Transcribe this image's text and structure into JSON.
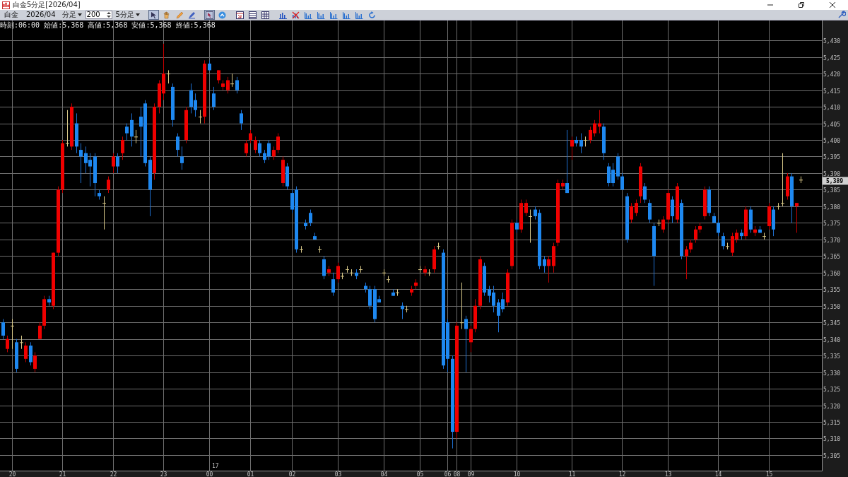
{
  "window": {
    "title": "白金5分足[2026/04]"
  },
  "toolbar": {
    "symbol": "白金",
    "month": "2026/04",
    "unit": "分足",
    "count": "200",
    "period": "5分足",
    "tools": [
      {
        "kind": "select",
        "selected": true
      },
      {
        "kind": "hand",
        "selected": false
      },
      {
        "kind": "pencil",
        "selected": false
      },
      {
        "kind": "pen",
        "selected": false
      },
      {
        "kind": "pointer",
        "selected": true
      },
      {
        "kind": "circle",
        "selected": false
      },
      {
        "kind": "window",
        "selected": false
      },
      {
        "kind": "list",
        "selected": false
      },
      {
        "kind": "grid",
        "selected": false
      },
      {
        "kind": "barsmenu",
        "selected": false
      },
      {
        "kind": "delete",
        "selected": false
      },
      {
        "kind": "bars",
        "selected": false
      },
      {
        "kind": "bars",
        "selected": false
      },
      {
        "kind": "bars",
        "selected": false
      },
      {
        "kind": "bars",
        "selected": false
      },
      {
        "kind": "bars",
        "selected": false
      },
      {
        "kind": "refresh",
        "selected": false
      }
    ]
  },
  "info_line": "時刻:06:00 始値:5,368 高値:5,368 安値:5,368 終値:5,368",
  "chart": {
    "date_marker": "17",
    "last_price": "5,389",
    "chart_data": {
      "type": "candlestick",
      "categories": [
        null,
        null,
        "20",
        null,
        null,
        null,
        null,
        null,
        null,
        null,
        null,
        null,
        null,
        "21",
        null,
        null,
        null,
        null,
        null,
        null,
        null,
        null,
        null,
        null,
        "22",
        null,
        null,
        null,
        null,
        null,
        null,
        null,
        null,
        null,
        null,
        "23",
        null,
        null,
        null,
        null,
        null,
        null,
        null,
        null,
        null,
        "00",
        null,
        null,
        null,
        null,
        null,
        null,
        null,
        null,
        "01",
        null,
        null,
        null,
        null,
        null,
        null,
        null,
        null,
        "02",
        null,
        null,
        null,
        null,
        null,
        null,
        null,
        null,
        null,
        "03",
        null,
        null,
        null,
        null,
        null,
        null,
        null,
        null,
        null,
        "04",
        null,
        null,
        null,
        null,
        null,
        null,
        null,
        "05",
        null,
        null,
        null,
        null,
        null,
        "06",
        null,
        "08",
        null,
        null,
        "09",
        null,
        null,
        null,
        null,
        null,
        null,
        null,
        null,
        null,
        "10",
        null,
        null,
        null,
        null,
        null,
        null,
        null,
        null,
        null,
        null,
        null,
        "11",
        null,
        null,
        null,
        null,
        null,
        null,
        null,
        null,
        null,
        null,
        "12",
        null,
        null,
        null,
        null,
        null,
        null,
        null,
        null,
        null,
        "13",
        null,
        null,
        null,
        null,
        null,
        null,
        null,
        null,
        null,
        null,
        "14",
        null,
        null,
        null,
        null,
        null,
        null,
        null,
        null,
        null,
        null,
        "15",
        null,
        null,
        null,
        null,
        null,
        null,
        null
      ],
      "ohlc": [
        [
          5345,
          5346,
          5340,
          5341
        ],
        [
          5337,
          5341,
          5336,
          5340
        ],
        [
          5344,
          5346,
          5337,
          5344
        ],
        [
          5339,
          5340,
          5330,
          5331
        ],
        [
          5339,
          5341,
          5337,
          5339
        ],
        [
          5334,
          5339,
          5333,
          5338
        ],
        [
          5338,
          5339,
          5332,
          5333
        ],
        [
          5331,
          5336,
          5330,
          5335
        ],
        [
          5340,
          5345,
          5340,
          5344
        ],
        [
          5344,
          5353,
          5343,
          5352
        ],
        [
          5352,
          5353,
          5350,
          5351
        ],
        [
          5350,
          5366,
          5349,
          5366
        ],
        [
          5366,
          5386,
          5365,
          5385
        ],
        [
          5385,
          5400,
          5384,
          5399
        ],
        [
          5399,
          5409,
          5398,
          5399
        ],
        [
          5398,
          5411,
          5397,
          5410
        ],
        [
          5405,
          5408,
          5396,
          5398
        ],
        [
          5397,
          5399,
          5387,
          5395
        ],
        [
          5396,
          5398,
          5390,
          5393
        ],
        [
          5394,
          5396,
          5386,
          5392
        ],
        [
          5395,
          5396,
          5383,
          5387
        ],
        [
          5384,
          5385,
          5382,
          5383
        ],
        [
          5381,
          5383,
          5373,
          5381
        ],
        [
          5385,
          5389,
          5384,
          5388
        ],
        [
          5392,
          5396,
          5390,
          5395
        ],
        [
          5395,
          5396,
          5390,
          5392
        ],
        [
          5396,
          5401,
          5394,
          5400
        ],
        [
          5404,
          5405,
          5400,
          5402
        ],
        [
          5406,
          5408,
          5398,
          5401
        ],
        [
          5401,
          5403,
          5399,
          5401
        ],
        [
          5407,
          5410,
          5395,
          5404
        ],
        [
          5411,
          5412,
          5392,
          5393
        ],
        [
          5394,
          5395,
          5377,
          5385
        ],
        [
          5390,
          5411,
          5388,
          5410
        ],
        [
          5410,
          5418,
          5408,
          5417
        ],
        [
          5414,
          5429,
          5412,
          5420
        ],
        [
          5420,
          5421,
          5417,
          5420
        ],
        [
          5416,
          5417,
          5404,
          5406
        ],
        [
          5401,
          5402,
          5395,
          5397
        ],
        [
          5395,
          5398,
          5391,
          5393
        ],
        [
          5400,
          5410,
          5399,
          5409
        ],
        [
          5415,
          5417,
          5408,
          5410
        ],
        [
          5412,
          5414,
          5407,
          5409
        ],
        [
          5407,
          5409,
          5405,
          5407
        ],
        [
          5407,
          5424,
          5405,
          5423
        ],
        [
          5423,
          5424,
          5421,
          5421
        ],
        [
          5414,
          5416,
          5409,
          5410
        ],
        [
          5418,
          5421,
          5417,
          5421
        ],
        [
          5416,
          5418,
          5415,
          5417
        ],
        [
          5415,
          5419,
          5414,
          5418
        ],
        [
          5417,
          5420,
          5416,
          5417
        ],
        [
          5418,
          5419,
          5414,
          5415
        ],
        [
          5408,
          5409,
          5403,
          5405
        ],
        [
          5396,
          5400,
          5395,
          5399
        ],
        [
          5400,
          5403,
          5399,
          5402
        ],
        [
          5397,
          5401,
          5396,
          5400
        ],
        [
          5399,
          5400,
          5395,
          5396
        ],
        [
          5396,
          5397,
          5393,
          5394
        ],
        [
          5399,
          5400,
          5394,
          5395
        ],
        [
          5395,
          5398,
          5394,
          5397
        ],
        [
          5397,
          5402,
          5396,
          5401
        ],
        [
          5387,
          5395,
          5386,
          5394
        ],
        [
          5392,
          5393,
          5385,
          5386
        ],
        [
          5384,
          5385,
          5378,
          5379
        ],
        [
          5385,
          5386,
          5366,
          5367
        ],
        [
          5367,
          5368,
          5366,
          5367
        ],
        [
          5375,
          5376,
          5373,
          5374
        ],
        [
          5378,
          5379,
          5374,
          5375
        ],
        [
          5371,
          5372,
          5370,
          5370
        ],
        [
          5367,
          5368,
          5366,
          5367
        ],
        [
          5364,
          5365,
          5358,
          5359
        ],
        [
          5360,
          5362,
          5359,
          5361
        ],
        [
          5358,
          5360,
          5353,
          5354
        ],
        [
          5358,
          5363,
          5357,
          5362
        ],
        [
          5359,
          5360,
          5358,
          5359
        ],
        [
          5361,
          5362,
          5360,
          5361
        ],
        [
          5360,
          5361,
          5359,
          5360
        ],
        [
          5360,
          5361,
          5358,
          5359
        ],
        [
          5361,
          5362,
          5360,
          5361
        ],
        [
          5356,
          5357,
          5354,
          5355
        ],
        [
          5355,
          5356,
          5349,
          5350
        ],
        [
          5355,
          5356,
          5345,
          5346
        ],
        [
          5352,
          5353,
          5351,
          5351
        ],
        [
          5360,
          5361,
          5359,
          5360
        ],
        [
          5358,
          5359,
          5357,
          5358
        ],
        [
          5354,
          5355,
          5353,
          5353
        ],
        [
          5354,
          5355,
          5353,
          5354
        ],
        [
          5350,
          5351,
          5346,
          5349
        ],
        [
          5349,
          5350,
          5348,
          5349
        ],
        [
          5354,
          5356,
          5353,
          5355
        ],
        [
          5356,
          5358,
          5355,
          5357
        ],
        [
          5361,
          5362,
          5360,
          5361
        ],
        [
          5360,
          5362,
          5359,
          5361
        ],
        [
          5360,
          5361,
          5359,
          5360
        ],
        [
          5361,
          5368,
          5360,
          5367
        ],
        [
          5368,
          5369,
          5367,
          5368
        ],
        [
          5366,
          5367,
          5331,
          5332
        ],
        [
          5345,
          5346,
          5330,
          5334
        ],
        [
          5334,
          5335,
          5307,
          5312
        ],
        [
          5312,
          5345,
          5310,
          5344
        ],
        [
          5345,
          5357,
          5343,
          5345
        ],
        [
          5346,
          5347,
          5330,
          5343
        ],
        [
          5339,
          5344,
          5336,
          5343
        ],
        [
          5343,
          5352,
          5342,
          5350
        ],
        [
          5350,
          5365,
          5349,
          5364
        ],
        [
          5362,
          5363,
          5353,
          5354
        ],
        [
          5355,
          5356,
          5351,
          5353
        ],
        [
          5354,
          5356,
          5348,
          5350
        ],
        [
          5351,
          5352,
          5342,
          5347
        ],
        [
          5352,
          5354,
          5348,
          5349
        ],
        [
          5351,
          5361,
          5350,
          5360
        ],
        [
          5362,
          5376,
          5361,
          5375
        ],
        [
          5375,
          5376,
          5372,
          5373
        ],
        [
          5373,
          5382,
          5372,
          5381
        ],
        [
          5378,
          5382,
          5377,
          5381
        ],
        [
          5377,
          5379,
          5369,
          5377
        ],
        [
          5379,
          5380,
          5376,
          5377
        ],
        [
          5378,
          5379,
          5361,
          5362
        ],
        [
          5364,
          5365,
          5360,
          5362
        ],
        [
          5362,
          5365,
          5357,
          5364
        ],
        [
          5362,
          5369,
          5360,
          5368
        ],
        [
          5369,
          5388,
          5368,
          5387
        ],
        [
          5386,
          5388,
          5385,
          5387
        ],
        [
          5387,
          5403,
          5384,
          5384
        ],
        [
          5398,
          5401,
          5394,
          5400
        ],
        [
          5400,
          5401,
          5398,
          5399
        ],
        [
          5400,
          5402,
          5396,
          5398
        ],
        [
          5400,
          5401,
          5398,
          5400
        ],
        [
          5400,
          5404,
          5399,
          5403
        ],
        [
          5402,
          5406,
          5401,
          5405
        ],
        [
          5404,
          5409,
          5402,
          5405
        ],
        [
          5404,
          5405,
          5394,
          5396
        ],
        [
          5392,
          5393,
          5386,
          5387
        ],
        [
          5391,
          5393,
          5386,
          5387
        ],
        [
          5395,
          5396,
          5388,
          5389
        ],
        [
          5389,
          5390,
          5385,
          5385
        ],
        [
          5383,
          5384,
          5369,
          5370
        ],
        [
          5376,
          5381,
          5375,
          5380
        ],
        [
          5378,
          5382,
          5377,
          5381
        ],
        [
          5383,
          5393,
          5381,
          5392
        ],
        [
          5386,
          5387,
          5381,
          5382
        ],
        [
          5381,
          5382,
          5375,
          5376
        ],
        [
          5374,
          5375,
          5356,
          5365
        ],
        [
          5375,
          5376,
          5374,
          5375
        ],
        [
          5373,
          5377,
          5372,
          5376
        ],
        [
          5376,
          5385,
          5375,
          5384
        ],
        [
          5382,
          5383,
          5375,
          5377
        ],
        [
          5376,
          5387,
          5375,
          5386
        ],
        [
          5381,
          5382,
          5364,
          5365
        ],
        [
          5365,
          5368,
          5358,
          5367
        ],
        [
          5367,
          5370,
          5366,
          5369
        ],
        [
          5370,
          5374,
          5369,
          5373
        ],
        [
          5373,
          5375,
          5372,
          5374
        ],
        [
          5377,
          5386,
          5376,
          5385
        ],
        [
          5385,
          5386,
          5377,
          5378
        ],
        [
          5377,
          5378,
          5375,
          5375
        ],
        [
          5375,
          5376,
          5371,
          5372
        ],
        [
          5371,
          5372,
          5367,
          5368
        ],
        [
          5368,
          5369,
          5367,
          5368
        ],
        [
          5366,
          5372,
          5365,
          5371
        ],
        [
          5370,
          5373,
          5369,
          5372
        ],
        [
          5372,
          5373,
          5370,
          5371
        ],
        [
          5371,
          5380,
          5370,
          5379
        ],
        [
          5379,
          5380,
          5372,
          5373
        ],
        [
          5372,
          5374,
          5371,
          5373
        ],
        [
          5373,
          5374,
          5372,
          5372
        ],
        [
          5371,
          5372,
          5370,
          5371
        ],
        [
          5374,
          5381,
          5373,
          5380
        ],
        [
          5379,
          5380,
          5371,
          5373
        ],
        [
          5380,
          5381,
          5379,
          5380
        ],
        [
          5381,
          5396,
          5380,
          5381
        ],
        [
          5383,
          5390,
          5382,
          5389
        ],
        [
          5389,
          5390,
          5375,
          5380
        ],
        [
          5380,
          5381,
          5372,
          5381
        ],
        [
          5388,
          5389,
          5387,
          5388
        ]
      ],
      "ylim": [
        5300.3,
        5436.0
      ],
      "grid": true,
      "yticks": [
        {
          "value": 5430,
          "label": "5,430"
        },
        {
          "value": 5425,
          "label": "5,425"
        },
        {
          "value": 5420,
          "label": "5,420"
        },
        {
          "value": 5415,
          "label": "5,415"
        },
        {
          "value": 5410,
          "label": "5,410"
        },
        {
          "value": 5405,
          "label": "5,405"
        },
        {
          "value": 5400,
          "label": "5,400"
        },
        {
          "value": 5395,
          "label": "5,395"
        },
        {
          "value": 5390,
          "label": "5,390"
        },
        {
          "value": 5385,
          "label": "5,385"
        },
        {
          "value": 5380,
          "label": "5,380"
        },
        {
          "value": 5375,
          "label": "5,375"
        },
        {
          "value": 5370,
          "label": "5,370"
        },
        {
          "value": 5365,
          "label": "5,365"
        },
        {
          "value": 5360,
          "label": "5,360"
        },
        {
          "value": 5355,
          "label": "5,355"
        },
        {
          "value": 5350,
          "label": "5,350"
        },
        {
          "value": 5345,
          "label": "5,345"
        },
        {
          "value": 5340,
          "label": "5,340"
        },
        {
          "value": 5335,
          "label": "5,335"
        },
        {
          "value": 5330,
          "label": "5,330"
        },
        {
          "value": 5325,
          "label": "5,325"
        },
        {
          "value": 5320,
          "label": "5,320"
        },
        {
          "value": 5315,
          "label": "5,315"
        },
        {
          "value": 5310,
          "label": "5,310"
        },
        {
          "value": 5305,
          "label": "5,305"
        }
      ]
    }
  }
}
